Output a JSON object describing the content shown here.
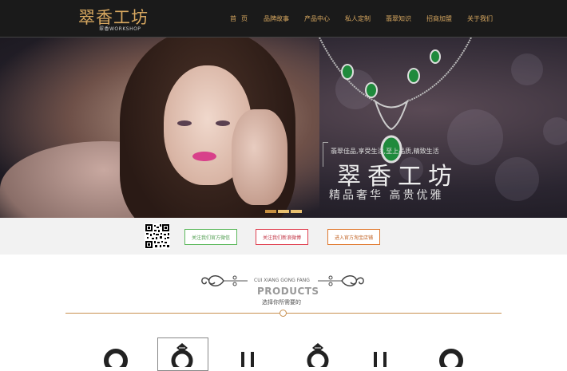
{
  "header": {
    "logo_main": "翠香工坊",
    "logo_sub": "翠香WORKSHOP",
    "nav": [
      {
        "label": "首页"
      },
      {
        "label": "品牌故事"
      },
      {
        "label": "产品中心"
      },
      {
        "label": "私人定制"
      },
      {
        "label": "翡翠知识"
      },
      {
        "label": "招商加盟"
      },
      {
        "label": "关于我们"
      }
    ]
  },
  "banner": {
    "tagline": "翡翠佳品,享受生活,至上品质,精致生活",
    "title": "翠香工坊",
    "subtitle": "精品奢华 高贵优雅",
    "slides": 3,
    "active_slide": 1
  },
  "follow": {
    "btn_wechat": "关注我们官方微信",
    "btn_weibo": "关注我们新浪微博",
    "btn_taobao": "进入官方淘宝店铺"
  },
  "products": {
    "pinyin": "CUI XIANG GONG FANG",
    "title": "PRODUCTS",
    "subtitle": "选择你所需要的"
  },
  "colors": {
    "accent": "#d8a860",
    "header_bg": "#1a1a1a",
    "divider": "#c89050"
  }
}
